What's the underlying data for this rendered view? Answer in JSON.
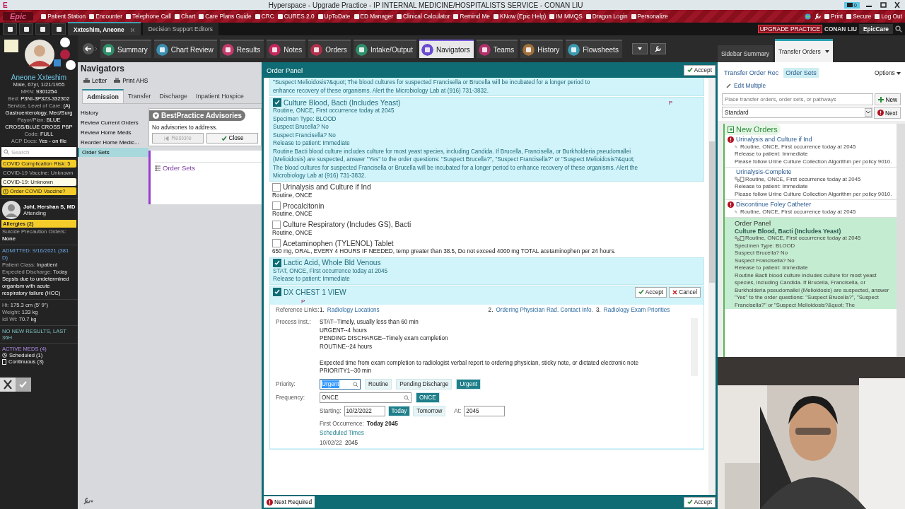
{
  "window": {
    "icon_letter": "E",
    "title": "Hyperspace - Upgrade Practice - IP INTERNAL MEDICINE/HOSPITALISTS  SERVICE - CONAN LIU",
    "mail_count": "0"
  },
  "toolbar": {
    "logo": "Epic",
    "items": [
      "Patient Station",
      "Encounter",
      "Telephone Call",
      "Chart",
      "Care Plans Guide",
      "CRC",
      "CURES 2.0",
      "UpToDate",
      "ED Manager",
      "Clinical Calculator",
      "Remind Me",
      "KNow (Epic Help)",
      "IM MMQS",
      "Dragon Login",
      "Personalize"
    ],
    "right_items": [
      "Print",
      "Secure",
      "Log Out"
    ]
  },
  "workspace_tabs": [
    {
      "label": "Xxteshim, Aneone",
      "selected": true
    },
    {
      "label": "Decision Support Editors",
      "selected": false
    }
  ],
  "environment": {
    "mode": "UPGRADE PRACTICE",
    "user": "CONAN LIU",
    "app": "EpicCare"
  },
  "activity_tabs": [
    {
      "label": "Summary",
      "selected": false
    },
    {
      "label": "Chart Review",
      "selected": false
    },
    {
      "label": "Results",
      "selected": false
    },
    {
      "label": "Notes",
      "selected": false
    },
    {
      "label": "Orders",
      "selected": false
    },
    {
      "label": "Intake/Output",
      "selected": false
    },
    {
      "label": "Navigators",
      "selected": true
    },
    {
      "label": "Teams",
      "selected": false
    },
    {
      "label": "History",
      "selected": false
    },
    {
      "label": "Flowsheets",
      "selected": false
    }
  ],
  "sidebar_tabs": [
    {
      "label": "Sidebar Summary",
      "selected": false
    },
    {
      "label": "Transfer Orders",
      "selected": true
    }
  ],
  "patient": {
    "name": "Aneone Xxteshim",
    "demographics": "Male, 67yr, 1/21/1955",
    "fields": [
      {
        "label": "MRN:",
        "value": "9301254"
      },
      {
        "label": "Bed:",
        "value": "P3NI-3P323-332302"
      },
      {
        "label": "Service, Level of Care:",
        "value": "(A) Gastroenterology, Med/Surg"
      },
      {
        "label": "Payor/Plan:",
        "value": "BLUE CROSS/BLUE CROSS PBP"
      },
      {
        "label": "Code:",
        "value": "FULL"
      },
      {
        "label": "ACP Docs:",
        "value": "Yes - on file"
      }
    ],
    "search_placeholder": "Search",
    "badges": [
      {
        "kind": "warning",
        "label": "COVID Complication Risk:",
        "value": "5"
      },
      {
        "kind": "plain",
        "label": "COVID-19 Vaccine:",
        "value": "Unknown"
      },
      {
        "kind": "light",
        "label": "COVID-19:",
        "value": "Unknown"
      },
      {
        "kind": "action",
        "label": "Order COVID Vaccine?"
      }
    ],
    "provider": {
      "name": "Johl, Hershan S, MD",
      "role": "Attending"
    },
    "allergies": "Allergies (2)",
    "suicide": {
      "label": "Suicide Precaution Orders:",
      "value": "None"
    },
    "admitted": "ADMITTED: 9/16/2021 (381 D)",
    "visit": [
      {
        "label": "Patient Class:",
        "value": "Inpatient"
      },
      {
        "label": "Expected Discharge:",
        "value": "Today"
      }
    ],
    "diagnosis": "Sepsis due to undetermined organism with acute respiratory failure (HCC)",
    "measures": [
      {
        "label": "Ht:",
        "value": "175.3 cm (5' 9\")"
      },
      {
        "label": "Weight:",
        "value": "133 kg"
      },
      {
        "label": "Idl Wt:",
        "value": "70.7 kg"
      }
    ],
    "results": "NO NEW RESULTS, LAST 36H",
    "meds_title": "ACTIVE MEDS (4)",
    "meds": [
      "Scheduled (1)",
      "Continuous (3)"
    ]
  },
  "navigators": {
    "title": "Navigators",
    "actions": [
      "Letter",
      "Print AHS"
    ],
    "tabs": [
      {
        "label": "Admission",
        "selected": true
      },
      {
        "label": "Transfer",
        "selected": false
      },
      {
        "label": "Discharge",
        "selected": false
      },
      {
        "label": "Inpatient Hospice",
        "selected": false
      }
    ],
    "menu": [
      {
        "label": "History",
        "selected": false
      },
      {
        "label": "Review Current Orders",
        "selected": false
      },
      {
        "label": "Review Home Meds",
        "selected": false
      },
      {
        "label": "Reorder Home Medic...",
        "selected": false
      },
      {
        "label": "Order Sets",
        "selected": true
      }
    ],
    "advisories": {
      "title": "BestPractice Advisories",
      "message": "No advisories to address.",
      "buttons": [
        {
          "label": "Restore",
          "disabled": true
        },
        {
          "label": "Close",
          "disabled": false
        }
      ]
    },
    "section": "Order Sets"
  },
  "order_panel": {
    "title": "Order Panel",
    "accept": "Accept",
    "top_lines": [
      "\"Suspect Melioidosis?&quot;  The blood cultures for suspected Francisella or Brucella will be incubated for a longer period to",
      "enhance recovery of these organisms. Alert the Microbiology Lab at (916) 731-3832."
    ],
    "orders": [
      {
        "title": "Culture Blood, Bacti (Includes Yeast)",
        "checked": true,
        "flag": "P",
        "lines": [
          "Routine, ONCE, First occurrence today at 2045",
          "Specimen Type: BLOOD",
          "Suspect Brucella? No",
          "Suspect Francisella? No",
          "Release to patient: Immediate"
        ],
        "note": "Routine Bacti blood culture includes culture for most yeast species, including Candida. If Brucella, Francisella, or Burkholderia pseudomallei (Melioidosis) are suspected, answer \"Yes\" to the order questions: \"Suspect Brucella?\", \"Suspect Francisella?\" or \"Suspect Melioidosis?&quot;  The blood cultures for suspected Francisella or Brucella will be incubated for a longer period to enhance recovery of these organisms. Alert the Microbiology Lab at (916) 731-3832."
      },
      {
        "title": "Urinalysis and Culture if Ind",
        "checked": false,
        "lines": [
          "Routine, ONCE"
        ]
      },
      {
        "title": "Procalcitonin",
        "checked": false,
        "lines": [
          "Routine, ONCE"
        ]
      },
      {
        "title": "Culture Respiratory (Includes GS), Bacti",
        "checked": false,
        "lines": [
          "Routine, ONCE"
        ]
      },
      {
        "title": "Acetaminophen (TYLENOL) Tablet",
        "checked": false,
        "lines": [
          "650 mg, ORAL, EVERY 4 HOURS IF NEEDED, temp greater than 38.5, Do not exceed 4000 mg TOTAL acetaminophen per 24 hours."
        ]
      },
      {
        "title": "Lactic Acid, Whole Bld Venous",
        "checked": true,
        "lines": [
          "STAT, ONCE, First occurrence today at 2045",
          "Release to patient: Immediate"
        ]
      },
      {
        "title": "DX CHEST 1 VIEW",
        "checked": true,
        "flag": "P",
        "buttons": [
          "Accept",
          "Cancel"
        ],
        "form": {
          "links_label": "Reference Links:",
          "links": [
            {
              "number": "1.",
              "text": "Radiology Locations"
            },
            {
              "number": "2.",
              "text": "Ordering Physician Rad. Contact Info."
            },
            {
              "number": "3.",
              "text": "Radiology Exam Priorities"
            }
          ],
          "process_label": "Process Inst.:",
          "process_blocks": [
            [
              "STAT--Timely, usually less than 60 min",
              "URGENT--4 hours",
              "PENDING DISCHARGE--Timely exam completion",
              "ROUTINE--24 hours"
            ],
            [
              "Expected time from exam completion to radiologist verbal report to ordering physician, sticky note, or dictated electronic note",
              "PRIORITY1--30 min"
            ]
          ],
          "priority_label": "Priority:",
          "priority_value": "Urgent",
          "priority_options": [
            {
              "label": "Routine",
              "selected": false
            },
            {
              "label": "Pending Discharge",
              "selected": false
            },
            {
              "label": "Urgent",
              "selected": true
            }
          ],
          "frequency_label": "Frequency:",
          "frequency_value": "ONCE",
          "frequency_options": [
            {
              "label": "ONCE",
              "selected": true
            }
          ],
          "starting_label": "Starting:",
          "starting_value": "10/2/2022",
          "day_options": [
            {
              "label": "Today",
              "selected": true
            },
            {
              "label": "Tomorrow",
              "selected": false
            }
          ],
          "at_label": "At:",
          "at_value": "2045",
          "first_label": "First Occurrence:",
          "first_value": "Today 2045",
          "scheduled": "Scheduled Times",
          "schedule": [
            {
              "date": "10/02/22",
              "time": "2045"
            }
          ]
        }
      }
    ],
    "footer": {
      "next": "Next Required",
      "accept": "Accept"
    }
  },
  "transfer_orders": {
    "tabs": [
      {
        "label": "Transfer Order Rec",
        "selected": false
      },
      {
        "label": "Order Sets",
        "selected": true
      }
    ],
    "options": "Options",
    "edit": "Edit Multiple",
    "search_placeholder": "Place transfer orders, order sets, or pathways",
    "new": "New",
    "mode": "Standard",
    "next": "Next",
    "section": "New Orders",
    "items": [
      {
        "title": "Urinalysis and Culture if Ind",
        "alert": true,
        "lines": [
          "Routine,  ONCE, First occurrence today at 2045",
          "Release to patient:  Immediate",
          "Please follow Urine Culture Collection Algorithm per policy 9010."
        ]
      },
      {
        "title": "Urinalysis-Complete",
        "alert": false,
        "lines": [
          "Routine,  ONCE, First occurrence today at 2045",
          "Release to patient:  Immediate",
          "Please follow Urine Culture Collection Algorithm per policy 9010."
        ]
      },
      {
        "title": "Discontinue Foley Catheter",
        "alert": true,
        "lines": [
          "Routine,  ONCE, First occurrence today at 2045"
        ]
      }
    ],
    "group": {
      "title": "Order Panel",
      "order": "Culture Blood, Bacti (Includes Yeast)",
      "lines": [
        "Routine,  ONCE, First occurrence today at 2045",
        "Specimen Type:  BLOOD",
        "Suspect Brucella?  No",
        "Suspect Francisella?  No",
        "Release to patient:  Immediate",
        "Routine Bacti blood culture includes culture for most yeast species, including Candida.  If Brucella, Francisella, or Burkholderia pseudomallei (Melioidosis) are suspected, answer \"Yes\" to the order questions: \"Suspect Brucella?\", \"Suspect Francisella?\" or \"Suspect Melioidosis?&quot;  The"
      ]
    }
  }
}
